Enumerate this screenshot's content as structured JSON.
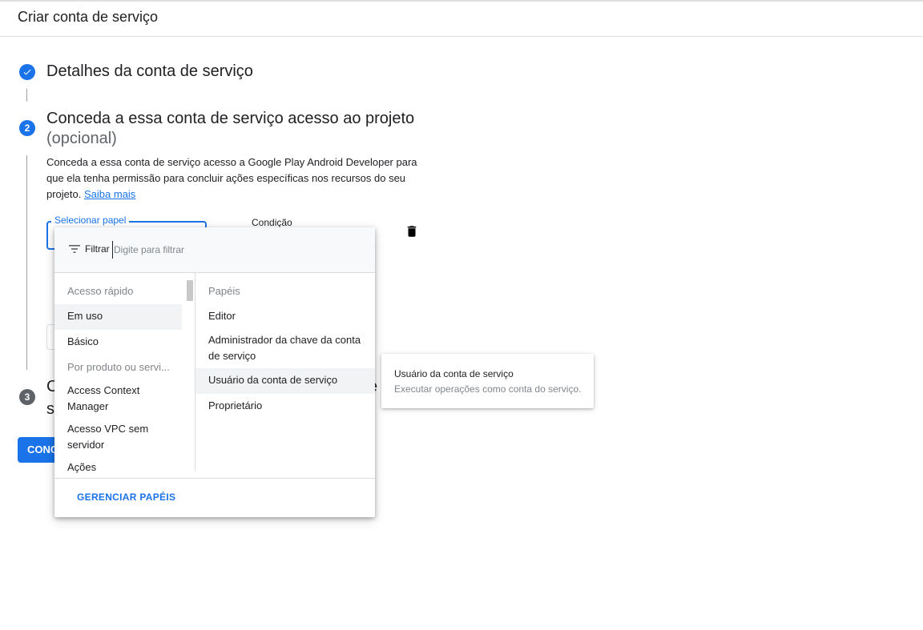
{
  "header": {
    "title": "Criar conta de serviço"
  },
  "steps": {
    "step1": {
      "number": "✓",
      "title": "Detalhes da conta de serviço"
    },
    "step2": {
      "number": "2",
      "title": "Conceda a essa conta de serviço acesso ao projeto",
      "optional": "(opcional)",
      "description": "Conceda a essa conta de serviço acesso a Google Play Android Developer para que ela tenha permissão para concluir ações específicas nos recursos do seu projeto.",
      "link": "Saiba mais",
      "role_label": "Selecionar papel",
      "condition_label": "Condição"
    },
    "step3": {
      "number": "3",
      "title_line1": "C",
      "title_line2": "s",
      "title_right": "e"
    }
  },
  "continue_button": "CONCLUIR",
  "dropdown": {
    "filter_label": "Filtrar",
    "filter_placeholder": "Digite para filtrar",
    "left_items": [
      {
        "label": "Acesso rápido",
        "type": "header"
      },
      {
        "label": "Em uso",
        "type": "item"
      },
      {
        "label": "Básico",
        "type": "item"
      },
      {
        "label": "Por produto ou servi...",
        "type": "header"
      },
      {
        "label": "Access Context Manager",
        "type": "item"
      },
      {
        "label": "Acesso VPC sem servidor",
        "type": "item"
      },
      {
        "label": "Ações",
        "type": "item"
      }
    ],
    "right_items": [
      {
        "label": "Papéis",
        "type": "header"
      },
      {
        "label": "Editor",
        "type": "item"
      },
      {
        "label": "Administrador da chave da conta de serviço",
        "type": "item"
      },
      {
        "label": "Usuário da conta de serviço",
        "type": "item"
      },
      {
        "label": "Proprietário",
        "type": "item"
      }
    ],
    "manage_button": "GERENCIAR PAPÉIS"
  },
  "tooltip": {
    "title": "Usuário da conta de serviço",
    "description": "Executar operações como conta do serviço."
  },
  "colors": {
    "primary": "#1a73e8",
    "step_inactive": "#5f6368"
  }
}
